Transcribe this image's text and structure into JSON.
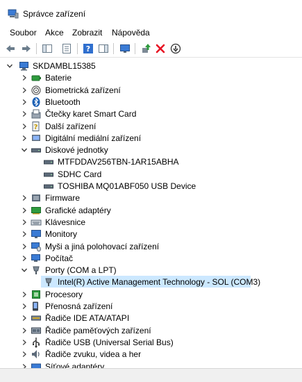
{
  "window": {
    "title": "Správce zařízení"
  },
  "menu": [
    "Soubor",
    "Akce",
    "Zobrazit",
    "Nápověda"
  ],
  "root": {
    "label": "SKDAMBL15385"
  },
  "tree": [
    {
      "label": "Baterie",
      "icon": "battery-icon",
      "expanded": false
    },
    {
      "label": "Biometrická zařízení",
      "icon": "fingerprint-icon",
      "expanded": false
    },
    {
      "label": "Bluetooth",
      "icon": "bluetooth-icon",
      "expanded": false
    },
    {
      "label": "Čtečky karet Smart Card",
      "icon": "smart-card-reader-icon",
      "expanded": false
    },
    {
      "label": "Další zařízení",
      "icon": "unknown-device-icon",
      "expanded": false
    },
    {
      "label": "Digitální mediální zařízení",
      "icon": "media-device-icon",
      "expanded": false
    },
    {
      "label": "Diskové jednotky",
      "icon": "disk-drive-icon",
      "expanded": true,
      "children": [
        "MTFDDAV256TBN-1AR15ABHA",
        "SDHC Card",
        "TOSHIBA MQ01ABF050 USB Device"
      ]
    },
    {
      "label": "Firmware",
      "icon": "firmware-icon",
      "expanded": false
    },
    {
      "label": "Grafické adaptéry",
      "icon": "display-adapter-icon",
      "expanded": false
    },
    {
      "label": "Klávesnice",
      "icon": "keyboard-icon",
      "expanded": false
    },
    {
      "label": "Monitory",
      "icon": "monitor-icon",
      "expanded": false
    },
    {
      "label": "Myši a jiná polohovací zařízení",
      "icon": "mouse-icon",
      "expanded": false
    },
    {
      "label": "Počítač",
      "icon": "computer-icon",
      "expanded": false
    },
    {
      "label": "Porty (COM a LPT)",
      "icon": "port-icon",
      "expanded": true,
      "children": [
        "Intel(R) Active Management Technology - SOL (COM3)"
      ]
    },
    {
      "label": "Procesory",
      "icon": "processor-icon",
      "expanded": false
    },
    {
      "label": "Přenosná zařízení",
      "icon": "portable-device-icon",
      "expanded": false
    },
    {
      "label": "Řadiče IDE ATA/ATAPI",
      "icon": "ide-controller-icon",
      "expanded": false
    },
    {
      "label": "Řadiče paměťových zařízení",
      "icon": "storage-controller-icon",
      "expanded": false
    },
    {
      "label": "Řadiče USB (Universal Serial Bus)",
      "icon": "usb-icon",
      "expanded": false
    },
    {
      "label": "Řadiče zvuku, videa a her",
      "icon": "sound-icon",
      "expanded": false
    },
    {
      "label": "Síťové adaptéry",
      "icon": "network-adapter-icon",
      "expanded": false
    }
  ],
  "selected": "Intel(R) Active Management Technology - SOL (COM3)",
  "colors": {
    "selection": "#cce8ff",
    "accent": "#0078d7",
    "remove": "#e81123",
    "enable": "#2e9b3e"
  }
}
